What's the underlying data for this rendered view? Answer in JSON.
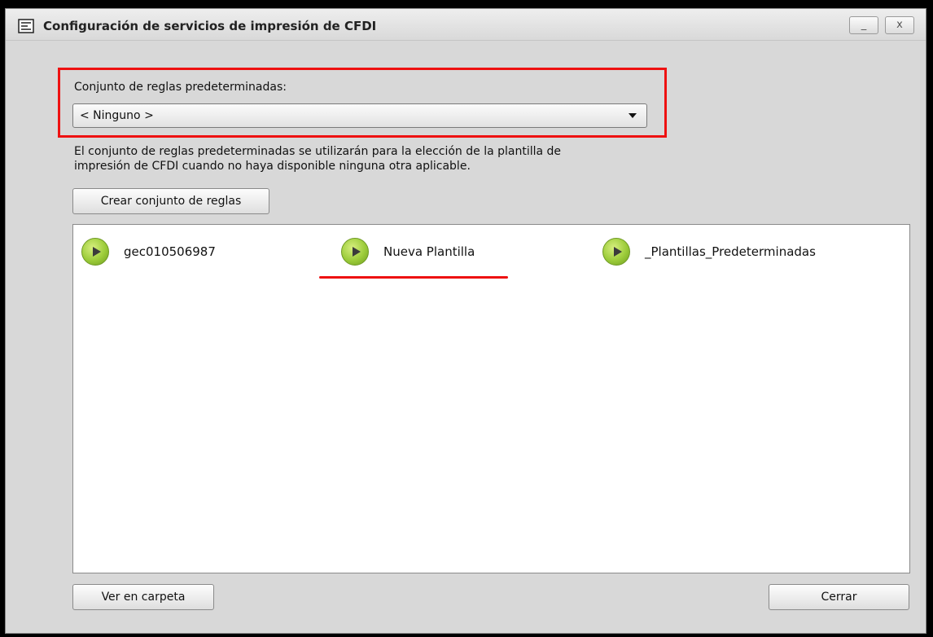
{
  "window": {
    "title": "Configuración de servicios de impresión de CFDI",
    "minimize_label": "_",
    "close_label": "x"
  },
  "rules": {
    "label": "Conjunto de reglas predeterminadas:",
    "selected": "< Ninguno >",
    "description_line1": "El conjunto de reglas predeterminadas se utilizarán para la elección de la plantilla de",
    "description_line2": "impresión de CFDI cuando no haya disponible ninguna otra aplicable.",
    "create_button": "Crear conjunto de reglas"
  },
  "templates": [
    {
      "label": "gec010506987",
      "icon": "play-icon"
    },
    {
      "label": "Nueva Plantilla",
      "icon": "play-icon"
    },
    {
      "label": "_Plantillas_Predeterminadas",
      "icon": "play-icon"
    }
  ],
  "footer": {
    "folder_button": "Ver en carpeta",
    "close_button": "Cerrar"
  },
  "colors": {
    "annotation_red": "#ee1111",
    "play_green": "#9ccc3a"
  }
}
